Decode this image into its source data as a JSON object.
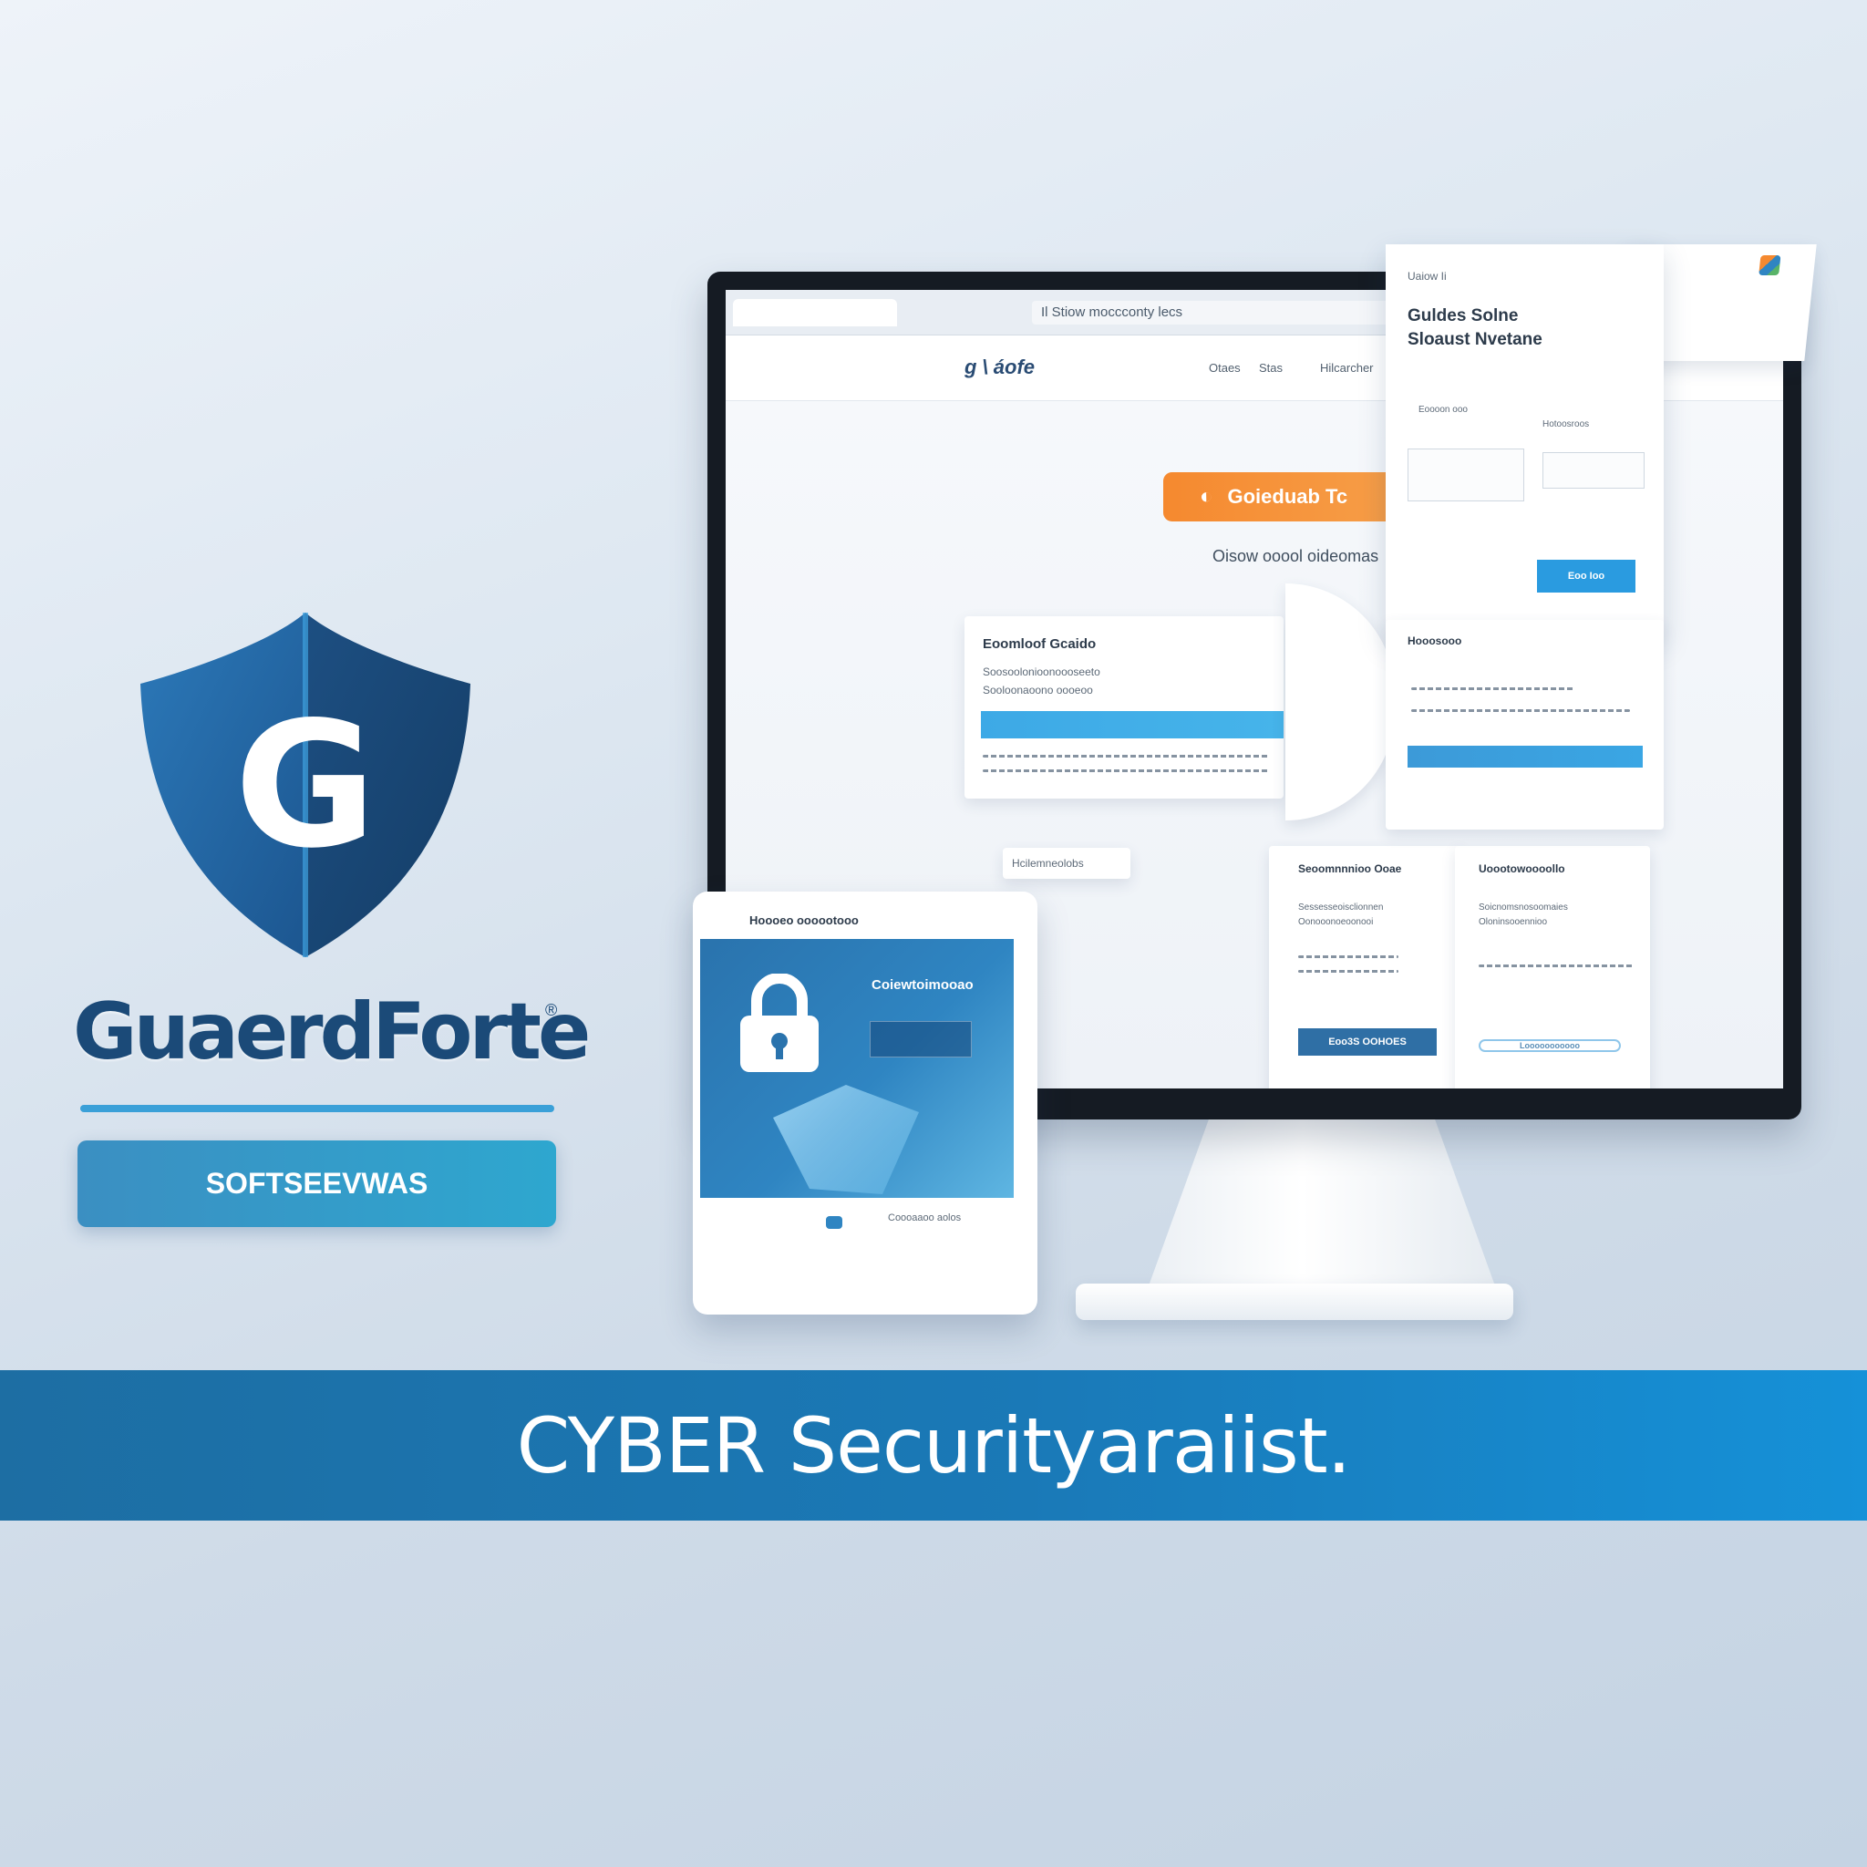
{
  "brand": {
    "name": "GuaerdForte",
    "registered_mark": "®",
    "tagline": "SOFTSEEVWAS",
    "shield_letter": "G",
    "colors": {
      "shield_dark": "#1b4a78",
      "shield_light": "#2f7fbf",
      "accent": "#3aa0d8"
    }
  },
  "monitor": {
    "url": "Il Stiow moccconty lecs",
    "site_logo": "g \\ áofe",
    "nav": [
      "Otaes",
      "Stas",
      "Hilcarcher"
    ],
    "cta_label": "Goieduab Tc",
    "cta_icon": "g-logo-icon",
    "hero_subtitle": "Oisow ooool oideomas",
    "card_main": {
      "title": "Eoomloof Gcaido",
      "lines": [
        "Soosoolonioonoooseeto",
        "Sooloonaoono oooeoo"
      ]
    },
    "small_label": "Hcilemneolobs",
    "panel_left": {
      "title": "Seoomnnnioo Ooae",
      "lines": [
        "Sessesseoisclionnen",
        "Oonooonoeoonooi"
      ],
      "button": "Eoo3S OOHOES"
    },
    "panel_right": {
      "title": "Uoootowoooollo",
      "lines": [
        "Soicnomsnosoomaies",
        "Oloninsooennioo"
      ],
      "button": "Looooooooooo"
    }
  },
  "float_window": {
    "tab_label": "Uaiow Ii",
    "title_line1": "Guldes Solne",
    "title_line2": "Sloaust Nvetane",
    "col1_label": "Eoooon ooo",
    "col2_label": "Hotoosroos",
    "button": "Eoo Ioo",
    "section_label": "Hooosooo",
    "corner_icon": "settings-badge-icon"
  },
  "tablet": {
    "header": "Hoooeo oooootooo",
    "screen_title": "Coiewtoimooao",
    "icon": "padlock-icon",
    "footer_text": "Coooaaoo aolos"
  },
  "banner": {
    "text": "CYBER Securityaraiist."
  }
}
